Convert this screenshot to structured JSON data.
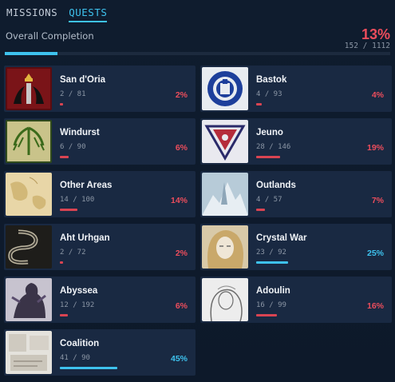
{
  "tabs": [
    {
      "label": "MISSIONS",
      "active": false
    },
    {
      "label": "QUESTS",
      "active": true
    }
  ],
  "overall": {
    "label": "Overall Completion",
    "percent": "13%",
    "count": "152 / 1112",
    "fill_fraction": 0.137
  },
  "colors": {
    "accent": "#3ec2ee",
    "low": "#ec4d5c",
    "card": "#192942"
  },
  "areas": [
    {
      "name": "San d'Oria",
      "count": "2 / 81",
      "percent": "2%",
      "fraction": 0.025,
      "status": "red",
      "icon": "sandoria-crest-icon"
    },
    {
      "name": "Bastok",
      "count": "4 / 93",
      "percent": "4%",
      "fraction": 0.043,
      "status": "red",
      "icon": "bastok-gear-icon"
    },
    {
      "name": "Windurst",
      "count": "6 / 90",
      "percent": "6%",
      "fraction": 0.067,
      "status": "red",
      "icon": "windurst-tree-icon"
    },
    {
      "name": "Jeuno",
      "count": "28 / 146",
      "percent": "19%",
      "fraction": 0.19,
      "status": "red",
      "icon": "jeuno-triangle-icon"
    },
    {
      "name": "Other Areas",
      "count": "14 / 100",
      "percent": "14%",
      "fraction": 0.14,
      "status": "red",
      "icon": "world-map-icon"
    },
    {
      "name": "Outlands",
      "count": "4 / 57",
      "percent": "7%",
      "fraction": 0.07,
      "status": "red",
      "icon": "outlands-ice-icon"
    },
    {
      "name": "Aht Urhgan",
      "count": "2 / 72",
      "percent": "2%",
      "fraction": 0.028,
      "status": "red",
      "icon": "aht-urhgan-serpent-icon"
    },
    {
      "name": "Crystal War",
      "count": "23 / 92",
      "percent": "25%",
      "fraction": 0.25,
      "status": "blue",
      "icon": "crystal-war-portrait-icon"
    },
    {
      "name": "Abyssea",
      "count": "12 / 192",
      "percent": "6%",
      "fraction": 0.063,
      "status": "red",
      "icon": "abyssea-creature-icon"
    },
    {
      "name": "Adoulin",
      "count": "16 / 99",
      "percent": "16%",
      "fraction": 0.16,
      "status": "red",
      "icon": "adoulin-sketch-icon"
    },
    {
      "name": "Coalition",
      "count": "41 / 90",
      "percent": "45%",
      "fraction": 0.45,
      "status": "blue",
      "icon": "coalition-sketch-icon"
    }
  ]
}
